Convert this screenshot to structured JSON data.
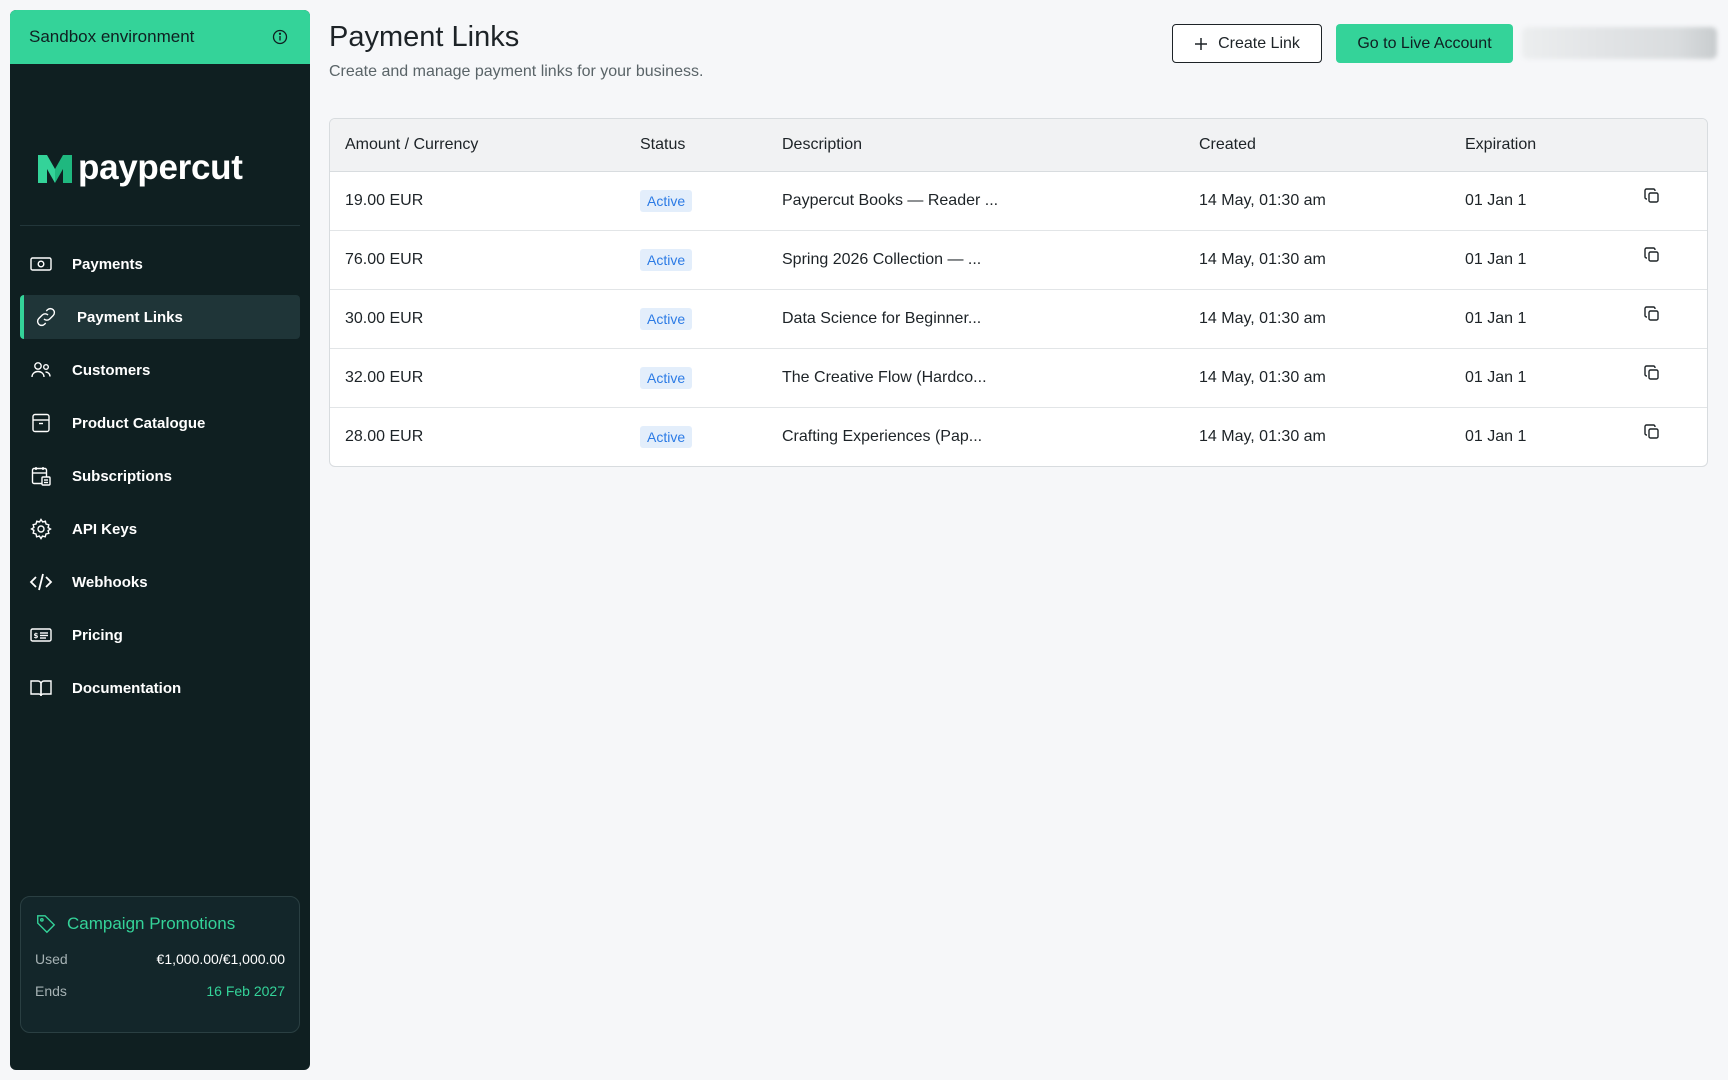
{
  "sidebar": {
    "env_label": "Sandbox environment",
    "brand": "paypercut",
    "items": [
      {
        "label": "Payments",
        "icon": "banknote-icon"
      },
      {
        "label": "Payment Links",
        "icon": "link-icon",
        "active": true
      },
      {
        "label": "Customers",
        "icon": "users-icon"
      },
      {
        "label": "Product Catalogue",
        "icon": "box-icon"
      },
      {
        "label": "Subscriptions",
        "icon": "calendar-stack-icon"
      },
      {
        "label": "API Keys",
        "icon": "gear-icon"
      },
      {
        "label": "Webhooks",
        "icon": "code-icon"
      },
      {
        "label": "Pricing",
        "icon": "price-card-icon"
      },
      {
        "label": "Documentation",
        "icon": "book-icon"
      }
    ],
    "promo": {
      "title": "Campaign Promotions",
      "used_label": "Used",
      "used_value": "€1,000.00/€1,000.00",
      "ends_label": "Ends",
      "ends_value": "16 Feb 2027"
    }
  },
  "header": {
    "title": "Payment Links",
    "subtitle": "Create and manage payment links for your business.",
    "create_label": "Create Link",
    "live_label": "Go to Live Account"
  },
  "table": {
    "columns": [
      "Amount / Currency",
      "Status",
      "Description",
      "Created",
      "Expiration"
    ],
    "rows": [
      {
        "amount": "19.00 EUR",
        "status": "Active",
        "description": "Paypercut Books — Reader ...",
        "created": "14 May, 01:30 am",
        "expiration": "01 Jan 1"
      },
      {
        "amount": "76.00 EUR",
        "status": "Active",
        "description": "Spring 2026 Collection — ...",
        "created": "14 May, 01:30 am",
        "expiration": "01 Jan 1"
      },
      {
        "amount": "30.00 EUR",
        "status": "Active",
        "description": "Data Science for Beginner...",
        "created": "14 May, 01:30 am",
        "expiration": "01 Jan 1"
      },
      {
        "amount": "32.00 EUR",
        "status": "Active",
        "description": "The Creative Flow (Hardco...",
        "created": "14 May, 01:30 am",
        "expiration": "01 Jan 1"
      },
      {
        "amount": "28.00 EUR",
        "status": "Active",
        "description": "Crafting Experiences (Pap...",
        "created": "14 May, 01:30 am",
        "expiration": "01 Jan 1"
      }
    ]
  },
  "colors": {
    "accent": "#34d399",
    "sidebar_bg": "#0f1f21",
    "badge_text": "#2c7be5",
    "badge_bg": "#e3eefb"
  }
}
